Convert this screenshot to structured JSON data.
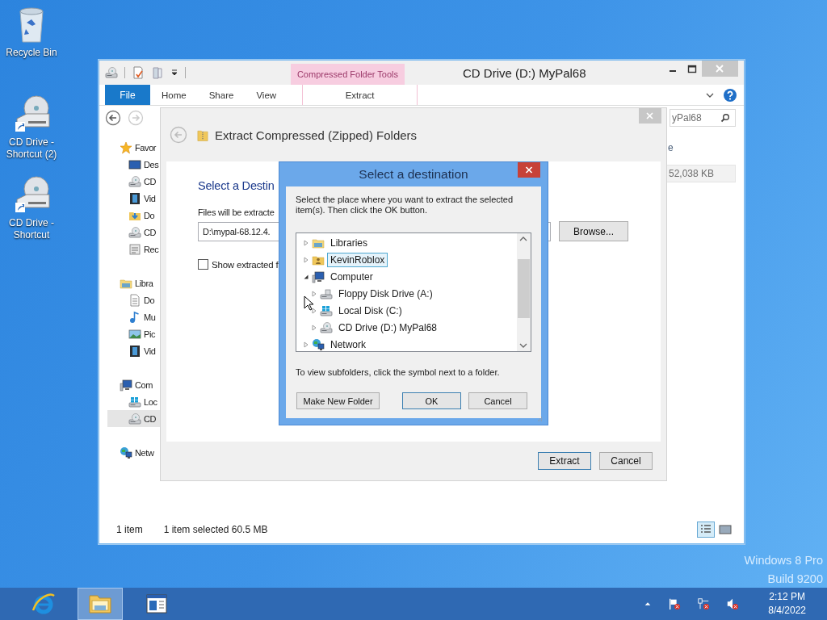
{
  "desktop_icons": [
    {
      "label": "Recycle Bin",
      "kind": "recycle"
    },
    {
      "label": "CD Drive - Shortcut (2)",
      "kind": "cd_shortcut"
    },
    {
      "label": "CD Drive - Shortcut",
      "kind": "cd_shortcut"
    }
  ],
  "explorer": {
    "title": "CD Drive (D:) MyPal68",
    "contextual_tab": "Compressed Folder Tools",
    "file_tab": "File",
    "tabs": [
      "Home",
      "Share",
      "View"
    ],
    "contextual_tabs": [
      "Extract"
    ],
    "search": {
      "placeholder": "yPal68"
    },
    "column_header": "e",
    "size_cell": "52,038 KB",
    "nav": [
      {
        "label": "Favor",
        "kind": "star",
        "selected": false,
        "children": [
          {
            "label": "Des",
            "kind": "desktop",
            "selected": false
          },
          {
            "label": "CD",
            "kind": "cd",
            "selected": false
          },
          {
            "label": "Vid",
            "kind": "video",
            "selected": false
          },
          {
            "label": "Do",
            "kind": "download",
            "selected": false
          },
          {
            "label": "CD",
            "kind": "cd",
            "selected": false
          },
          {
            "label": "Rec",
            "kind": "recent",
            "selected": false
          }
        ]
      },
      {
        "label": "Libra",
        "kind": "library",
        "selected": false,
        "children": [
          {
            "label": "Do",
            "kind": "document",
            "selected": false
          },
          {
            "label": "Mu",
            "kind": "music",
            "selected": false
          },
          {
            "label": "Pic",
            "kind": "picture",
            "selected": false
          },
          {
            "label": "Vid",
            "kind": "video",
            "selected": false
          }
        ]
      },
      {
        "label": "Com",
        "kind": "computer",
        "selected": false,
        "children": [
          {
            "label": "Loc",
            "kind": "disk",
            "selected": false
          },
          {
            "label": "CD",
            "kind": "cd",
            "selected": true
          }
        ]
      },
      {
        "label": "Netw",
        "kind": "network",
        "selected": false
      }
    ],
    "status": {
      "count": "1 item",
      "selection": "1 item selected  60.5 MB"
    },
    "views": [
      {
        "kind": "details",
        "selected": true
      },
      {
        "kind": "large_icons",
        "selected": false
      }
    ]
  },
  "wizard": {
    "title": "Extract Compressed (Zipped) Folders",
    "heading": "Select a Destin",
    "files_label": "Files will be extracte",
    "path": "D:\\mypal-68.12.4.",
    "browse": "Browse...",
    "show_label": "Show extracted f",
    "show_checked": false,
    "buttons": [
      {
        "label": "Extract",
        "default": true
      },
      {
        "label": "Cancel",
        "default": false
      }
    ]
  },
  "dialog": {
    "title": "Select a destination",
    "instructions": "Select the place where you want to extract the selected item(s).  Then click the OK button.",
    "tree": [
      {
        "label": "Libraries",
        "kind": "library",
        "expanded": false,
        "selected": false
      },
      {
        "label": "KevinRoblox",
        "kind": "user",
        "expanded": false,
        "selected": true
      },
      {
        "label": "Computer",
        "kind": "computer",
        "expanded": true,
        "selected": false,
        "children": [
          {
            "label": "Floppy Disk Drive (A:)",
            "kind": "floppy",
            "expanded": false,
            "selected": false
          },
          {
            "label": "Local Disk (C:)",
            "kind": "disk",
            "expanded": false,
            "selected": false
          },
          {
            "label": "CD Drive (D:) MyPal68",
            "kind": "cd",
            "expanded": false,
            "selected": false
          }
        ]
      },
      {
        "label": "Network",
        "kind": "network",
        "expanded": false,
        "selected": false
      }
    ],
    "hint": "To view subfolders, click the symbol next to a folder.",
    "buttons": [
      {
        "label": "Make New Folder",
        "default": false
      },
      {
        "label": "OK",
        "default": true
      },
      {
        "label": "Cancel",
        "default": false
      }
    ]
  },
  "desktop_text": [
    "Windows 8 Pro",
    "Build 9200"
  ],
  "taskbar": {
    "apps": [
      {
        "kind": "browser",
        "active": false
      },
      {
        "kind": "explorer",
        "active": true
      },
      {
        "kind": "app",
        "active": false
      }
    ],
    "clock": {
      "time": "2:12 PM",
      "date": "8/4/2022"
    }
  }
}
